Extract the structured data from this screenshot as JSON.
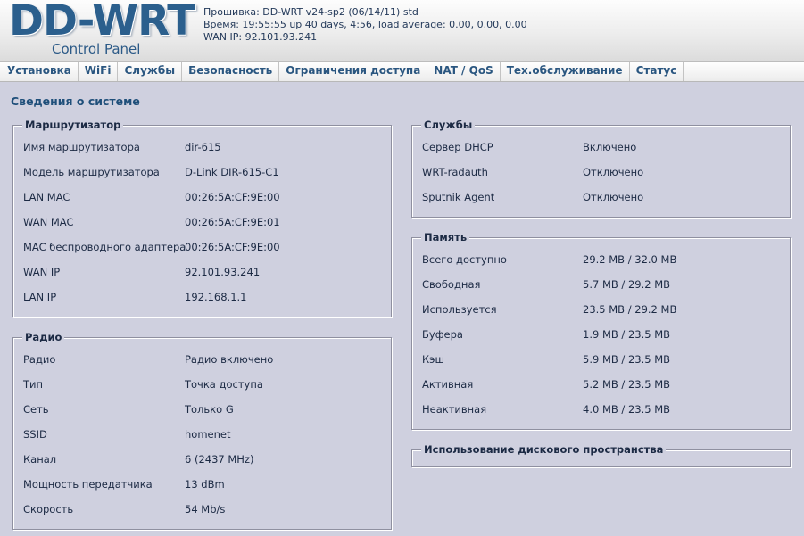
{
  "header": {
    "logo_title": "DD-WRT",
    "logo_subtitle": "Control Panel",
    "firmware": "Прошивка: DD-WRT v24-sp2 (06/14/11) std",
    "time": "Время: 19:55:55 up 40 days, 4:56, load average: 0.00, 0.00, 0.00",
    "wan_ip": "WAN IP: 92.101.93.241"
  },
  "nav": {
    "tabs": [
      "Установка",
      "WiFi",
      "Службы",
      "Безопасность",
      "Ограничения доступа",
      "NAT / QoS",
      "Тех.обслуживание",
      "Статус"
    ]
  },
  "page_title": "Сведения о системе",
  "router": {
    "legend": "Маршрутизатор",
    "rows": [
      {
        "label": "Имя маршрутизатора",
        "value": "dir-615"
      },
      {
        "label": "Модель маршрутизатора",
        "value": "D-Link DIR-615-C1"
      },
      {
        "label": "LAN MAC",
        "value": "00:26:5A:CF:9E:00"
      },
      {
        "label": "WAN MAC",
        "value": "00:26:5A:CF:9E:01"
      },
      {
        "label": "MAC беспроводного адаптера",
        "value": "00:26:5A:CF:9E:00"
      },
      {
        "label": "WAN IP",
        "value": "92.101.93.241"
      },
      {
        "label": "LAN IP",
        "value": "192.168.1.1"
      }
    ]
  },
  "radio": {
    "legend": "Радио",
    "rows": [
      {
        "label": "Радио",
        "value": "Радио включено"
      },
      {
        "label": "Тип",
        "value": "Точка доступа"
      },
      {
        "label": "Сеть",
        "value": "Только G"
      },
      {
        "label": "SSID",
        "value": "homenet"
      },
      {
        "label": "Канал",
        "value": "6 (2437 MHz)"
      },
      {
        "label": "Мощность передатчика",
        "value": "13 dBm"
      },
      {
        "label": "Скорость",
        "value": "54 Mb/s"
      }
    ]
  },
  "services": {
    "legend": "Службы",
    "rows": [
      {
        "label": "Сервер DHCP",
        "value": "Включено"
      },
      {
        "label": "WRT-radauth",
        "value": "Отключено"
      },
      {
        "label": "Sputnik Agent",
        "value": "Отключено"
      }
    ]
  },
  "memory": {
    "legend": "Память",
    "rows": [
      {
        "label": "Всего доступно",
        "value": "29.2 MB / 32.0 MB"
      },
      {
        "label": "Свободная",
        "value": "5.7 MB / 29.2 MB"
      },
      {
        "label": "Используется",
        "value": "23.5 MB / 29.2 MB"
      },
      {
        "label": "Буфера",
        "value": "1.9 MB / 23.5 MB"
      },
      {
        "label": "Кэш",
        "value": "5.9 MB / 23.5 MB"
      },
      {
        "label": "Активная",
        "value": "5.2 MB / 23.5 MB"
      },
      {
        "label": "Неактивная",
        "value": "4.0 MB / 23.5 MB"
      }
    ]
  },
  "disk": {
    "legend": "Использование дискового пространства"
  }
}
